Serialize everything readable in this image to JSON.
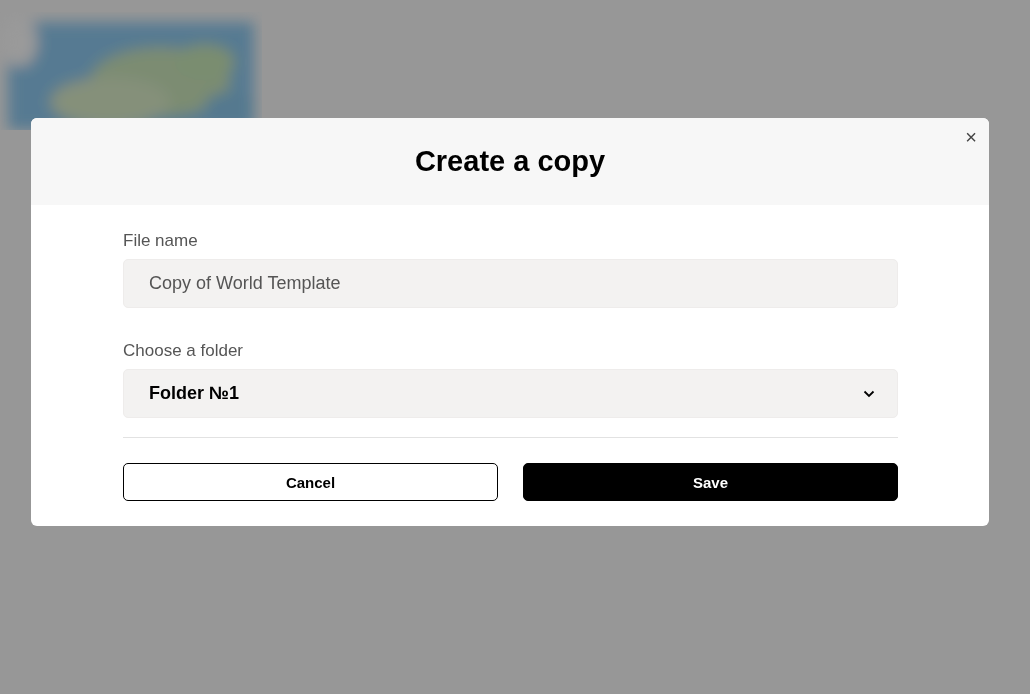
{
  "dialog": {
    "title": "Create a copy",
    "close": "×",
    "fields": [
      {
        "kind": "text",
        "label": "File name",
        "value": "Copy of World Template"
      },
      {
        "kind": "select",
        "label": "Choose a folder",
        "value": "Folder №1"
      }
    ],
    "buttons": [
      {
        "label": "Cancel",
        "primary": false
      },
      {
        "label": "Save",
        "primary": true
      }
    ]
  }
}
